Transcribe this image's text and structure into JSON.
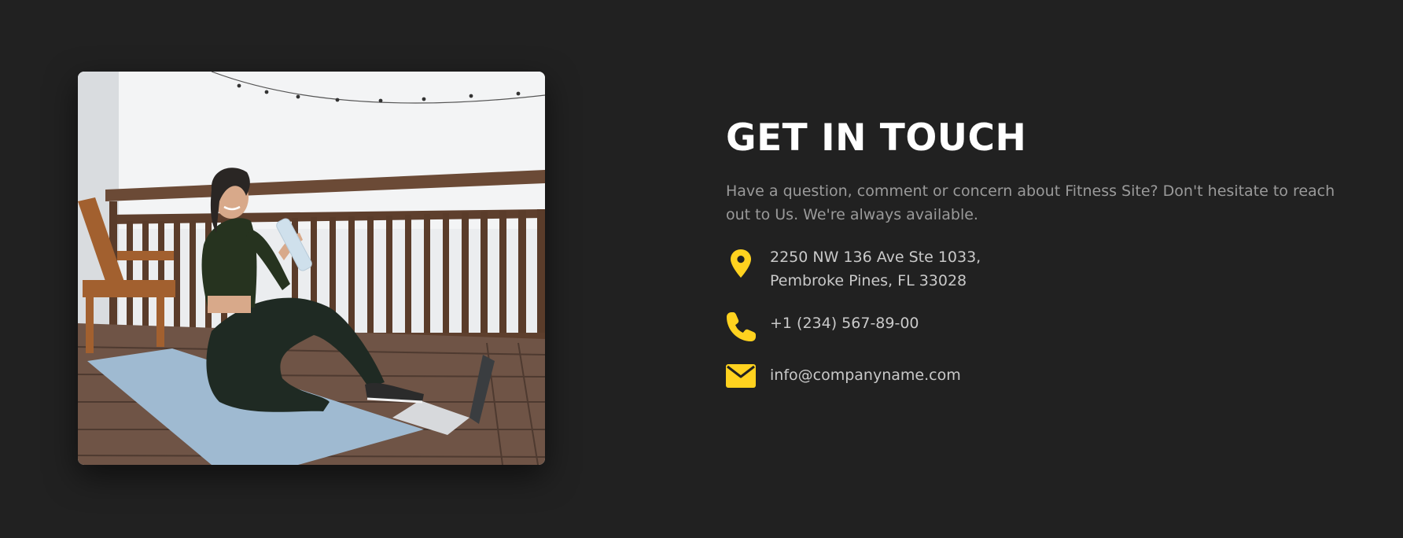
{
  "contact": {
    "heading": "GET IN TOUCH",
    "intro": "Have a question, comment or concern about Fitness Site? Don't hesitate to reach out to Us. We're always available.",
    "address": {
      "line1": "2250 NW 136 Ave Ste 1033,",
      "line2": "Pembroke Pines, FL 33028",
      "icon": "map-pin-icon"
    },
    "phone": {
      "value": "+1 (234) 567-89-00",
      "icon": "phone-icon"
    },
    "email": {
      "value": "info@companyname.com",
      "icon": "envelope-icon"
    }
  },
  "photo": {
    "subject": "woman-on-yoga-mat-drinking-water"
  },
  "colors": {
    "background": "#212121",
    "accent": "#ffd21f",
    "heading": "#ffffff",
    "intro_text": "#9a9a9a",
    "contact_text": "#c9c9c9"
  }
}
